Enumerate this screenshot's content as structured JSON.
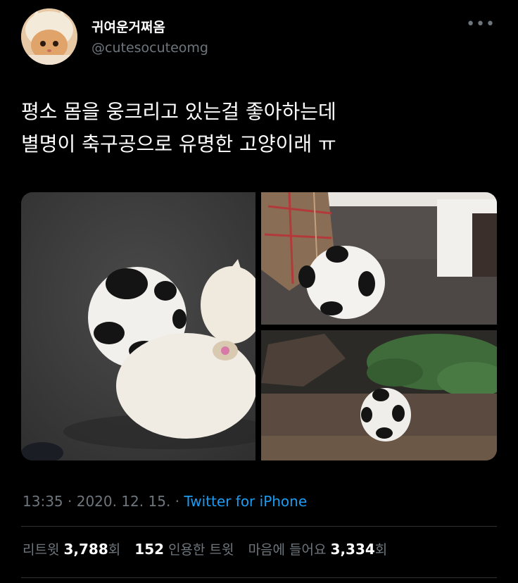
{
  "author": {
    "display_name": "귀여운거쩌옴",
    "handle": "@cutesocuteomg"
  },
  "more_label": "•••",
  "tweet": {
    "line1": "평소 몸을 웅크리고 있는걸 좋아하는데",
    "line2": "별명이 축구공으로 유명한 고양이래 ㅠ"
  },
  "meta": {
    "time": "13:35",
    "sep1": " · ",
    "date": "2020. 12. 15.",
    "sep2": " · ",
    "source": "Twitter for iPhone"
  },
  "stats": {
    "retweets_label": "리트윗 ",
    "retweets_count": "3,788",
    "retweets_suffix": "회",
    "quotes_count": "152",
    "quotes_label": " 인용한 트윗",
    "likes_label": "마음에 들어요 ",
    "likes_count": "3,334",
    "likes_suffix": "회"
  },
  "colors": {
    "background": "#000000",
    "text": "#ffffff",
    "muted": "#6e767d",
    "link": "#1d9bf0",
    "divider": "#2f3336"
  },
  "icons": {
    "avatar": "cat-avatar-icon",
    "more": "more-options-icon"
  }
}
